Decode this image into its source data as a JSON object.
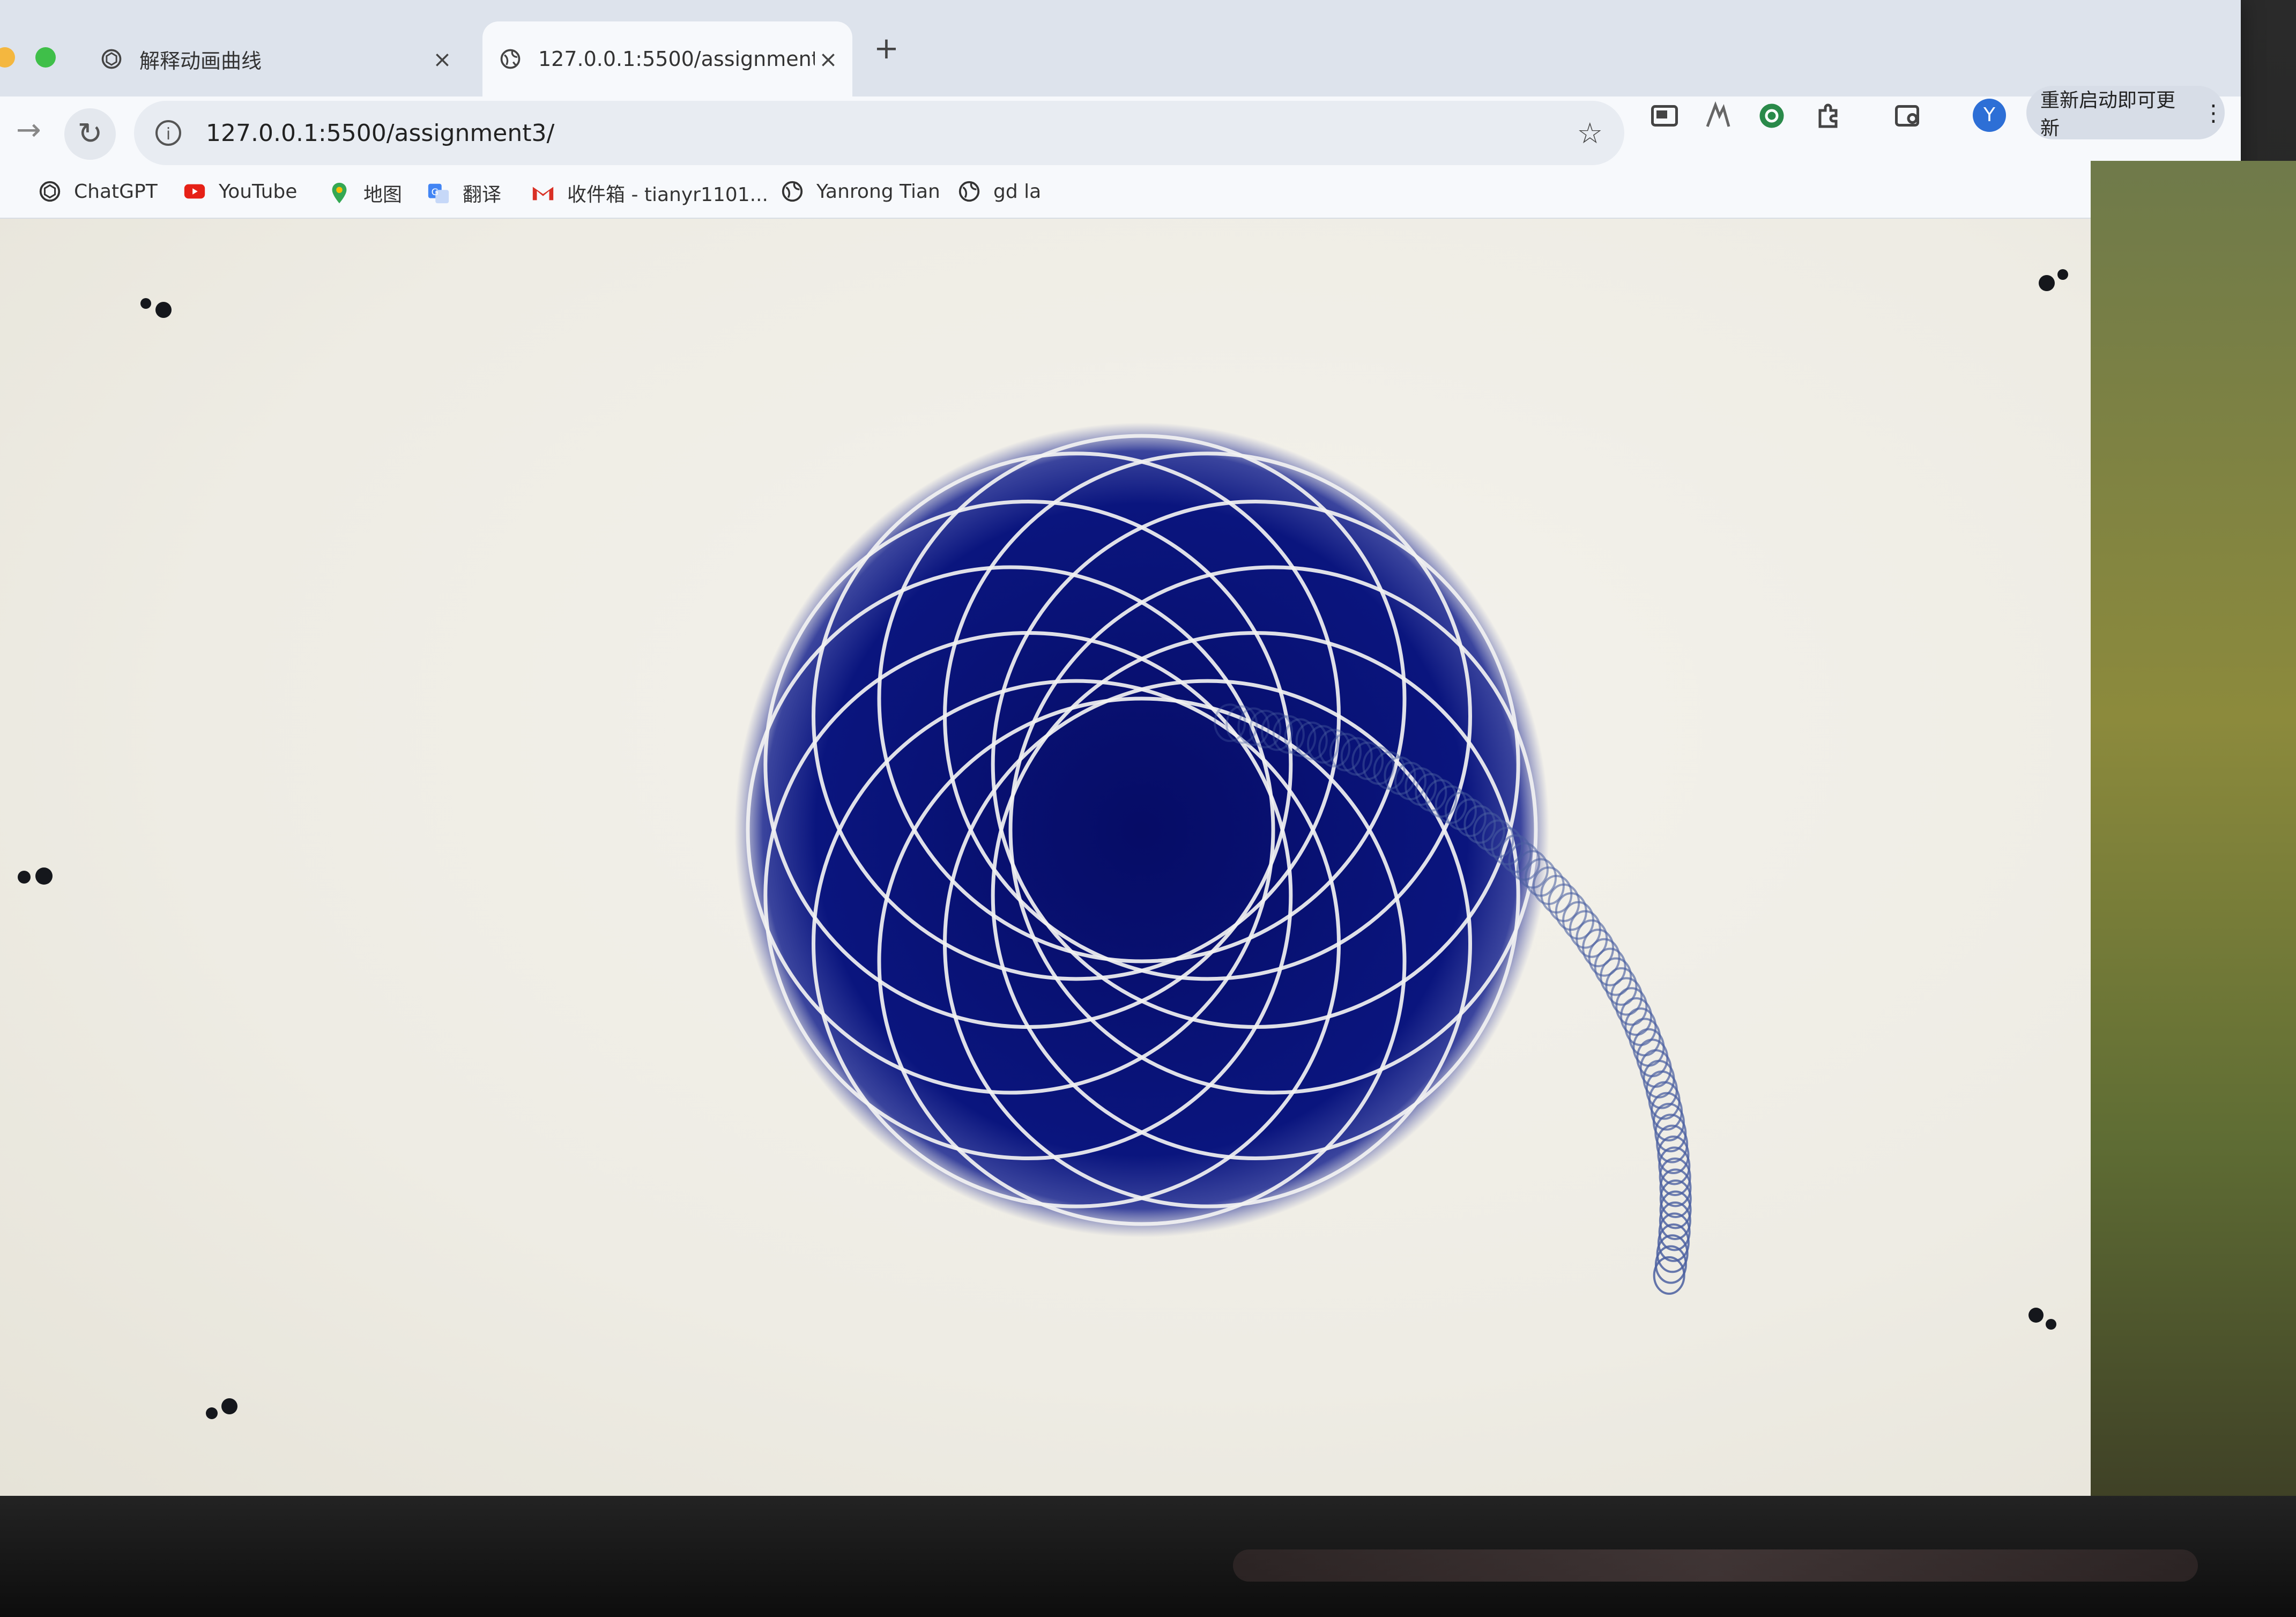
{
  "browser": {
    "tabs": [
      {
        "title": "解释动画曲线",
        "close": "×",
        "icon": "chatgpt-icon"
      },
      {
        "title": "127.0.0.1:5500/assignment3/",
        "close": "×",
        "icon": "globe-icon"
      }
    ],
    "new_tab_label": "+",
    "address": "127.0.0.1:5500/assignment3/",
    "profile_initial": "Y",
    "update_label": "重新启动即可更新",
    "update_menu": "⋮"
  },
  "bookmarks": [
    {
      "label": "ChatGPT",
      "icon": "chatgpt-icon"
    },
    {
      "label": "YouTube",
      "icon": "youtube-icon"
    },
    {
      "label": "地图",
      "icon": "maps-pin-icon"
    },
    {
      "label": "翻译",
      "icon": "translate-icon"
    },
    {
      "label": "收件箱 - tianyr1101...",
      "icon": "gmail-icon"
    },
    {
      "label": "Yanrong Tian",
      "icon": "globe-icon"
    },
    {
      "label": "gd la",
      "icon": "globe-icon"
    }
  ],
  "canvas": {
    "background": "#eeece4",
    "sphere_color": "#06106f",
    "ring_color": "#f2f2f2",
    "ring_count": 12,
    "trail_color": "#4a5fa0",
    "trail_ghost_count": 70,
    "dot_color": "#15171c",
    "dot_pair_count": 6
  }
}
